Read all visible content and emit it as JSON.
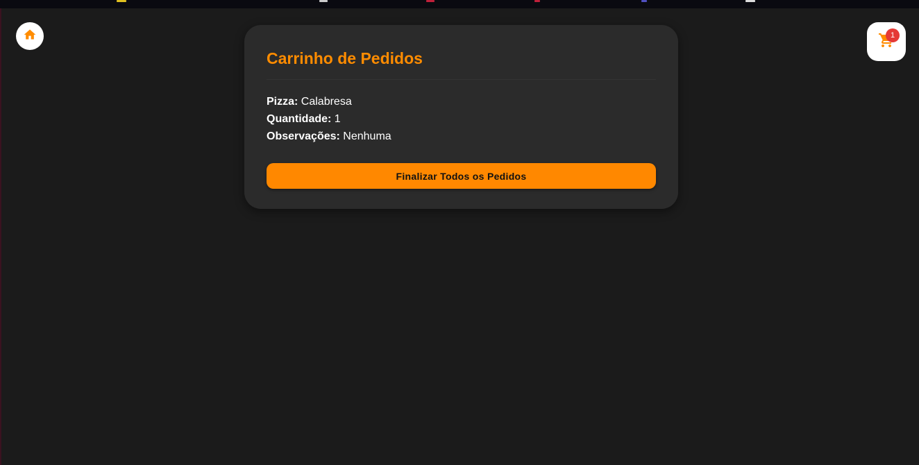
{
  "colors": {
    "background": "#1b1b1b",
    "card": "#2b2b2b",
    "accent": "#ff8c00",
    "button": "#ff8800",
    "badge": "#e53935"
  },
  "nav": {
    "home_icon": "home-icon",
    "cart_icon": "shopping-cart-icon",
    "cart_count": "1"
  },
  "cart": {
    "title": "Carrinho de Pedidos",
    "items": [
      {
        "pizza_label": "Pizza:",
        "pizza_value": "Calabresa",
        "quantity_label": "Quantidade:",
        "quantity_value": "1",
        "notes_label": "Observações:",
        "notes_value": "Nenhuma"
      }
    ],
    "finish_button_label": "Finalizar Todos os Pedidos"
  }
}
